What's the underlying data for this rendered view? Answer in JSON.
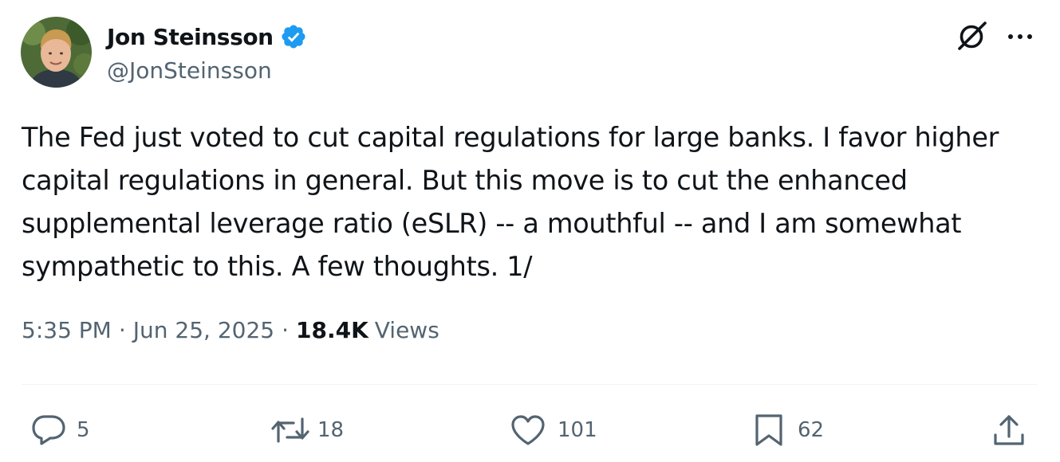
{
  "author": {
    "display_name": "Jon Steinsson",
    "handle": "@JonSteinsson",
    "verified": true
  },
  "tweet": {
    "text": "The Fed just voted to cut capital regulations for large banks. I favor higher\ncapital regulations in general. But this move is to cut the enhanced\nsupplemental leverage ratio (eSLR) -- a mouthful -- and I am somewhat\nsympathetic to this. A few thoughts. 1/",
    "time": "5:35 PM",
    "date": "Jun 25, 2025",
    "separator": "·",
    "views_count": "18.4K",
    "views_label": "Views"
  },
  "actions": {
    "replies": "5",
    "reposts": "18",
    "likes": "101",
    "bookmarks": "62"
  },
  "icons": {
    "verified": "verified-badge-icon",
    "grok": "grok-icon",
    "more": "more-options-icon",
    "reply": "reply-icon",
    "repost": "repost-icon",
    "like": "heart-icon",
    "bookmark": "bookmark-icon",
    "share": "share-icon"
  },
  "colors": {
    "text": "#0f1419",
    "secondary": "#536471",
    "verified_blue": "#1d9bf0",
    "divider": "#eff3f4"
  }
}
